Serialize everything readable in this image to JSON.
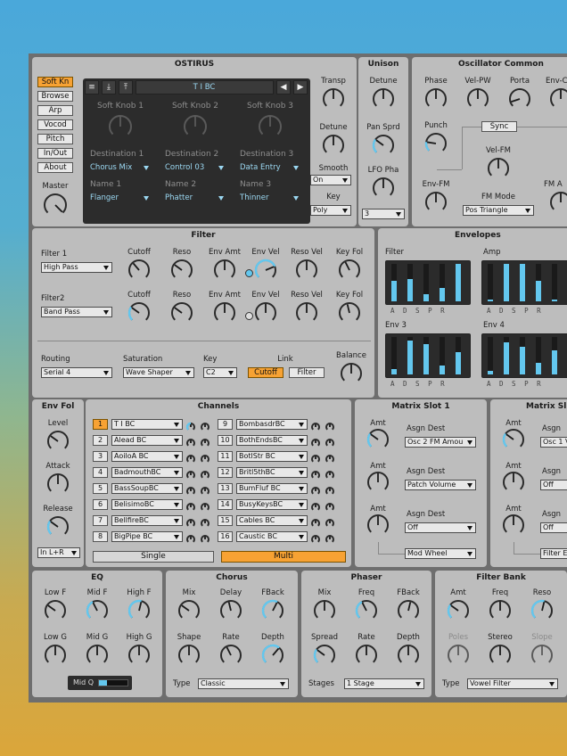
{
  "ostirus": {
    "title": "OSTIRUS",
    "side": [
      {
        "label": "Soft Kn",
        "on": true
      },
      {
        "label": "Browse",
        "on": false
      },
      {
        "label": "Arp",
        "on": false
      },
      {
        "label": "Vocod",
        "on": false
      },
      {
        "label": "Pitch",
        "on": false
      },
      {
        "label": "In/Out",
        "on": false
      },
      {
        "label": "About",
        "on": false
      }
    ],
    "master": "Master",
    "preset": "T I BC",
    "knobs": [
      "Soft Knob 1",
      "Soft Knob 2",
      "Soft Knob 3"
    ],
    "dest_labels": [
      "Destination 1",
      "Destination 2",
      "Destination 3"
    ],
    "dest_values": [
      "Chorus Mix",
      "Control 03",
      "Data Entry"
    ],
    "name_labels": [
      "Name 1",
      "Name 2",
      "Name 3"
    ],
    "name_values": [
      "Flanger",
      "Phatter",
      "Thinner"
    ],
    "transp": "Transp",
    "detune": "Detune",
    "smooth": "Smooth",
    "smooth_value": "On",
    "key": "Key",
    "key_value": "Poly"
  },
  "unison": {
    "title": "Unison",
    "detune": "Detune",
    "pan": "Pan Sprd",
    "lfo": "LFO Pha",
    "voices": "3"
  },
  "osc": {
    "title": "Oscillator Common",
    "phase": "Phase",
    "velpw": "Vel-PW",
    "porta": "Porta",
    "envc": "Env-C",
    "punch": "Punch",
    "sync": "Sync",
    "velfm": "Vel-FM",
    "envfm": "Env-FM",
    "fmmode": "FM Mode",
    "fmmode_value": "Pos Triangle",
    "fma": "FM A"
  },
  "filter": {
    "title": "Filter",
    "f1": "Filter 1",
    "f1_value": "High Pass",
    "f2": "Filter2",
    "f2_value": "Band Pass",
    "cols": [
      "Cutoff",
      "Reso",
      "Env Amt",
      "Env Vel",
      "Reso Vel",
      "Key Fol"
    ],
    "routing": "Routing",
    "routing_value": "Serial 4",
    "saturation": "Saturation",
    "saturation_value": "Wave Shaper",
    "key": "Key",
    "key_value": "C2",
    "link": "Link",
    "link_cutoff": "Cutoff",
    "link_filter": "Filter",
    "balance": "Balance"
  },
  "env": {
    "title": "Envelopes",
    "filter": "Filter",
    "amp": "Amp",
    "env3": "Env 3",
    "env4": "Env 4",
    "adsr": "A D S P R",
    "filter_levels": [
      0.55,
      0.6,
      0.2,
      0.35,
      1.0
    ],
    "amp_levels": [
      0.05,
      1.0,
      1.0,
      0.55,
      0.05
    ],
    "env3_levels": [
      0.15,
      0.9,
      0.8,
      0.25,
      0.6
    ],
    "env4_levels": [
      0.1,
      0.85,
      0.75,
      0.3,
      0.65
    ]
  },
  "envfol": {
    "title": "Env Fol",
    "level": "Level",
    "attack": "Attack",
    "release": "Release",
    "input": "In L+R"
  },
  "channels": {
    "title": "Channels",
    "left": [
      {
        "n": "1",
        "name": "T I BC",
        "on": true
      },
      {
        "n": "2",
        "name": "Alead BC",
        "on": false
      },
      {
        "n": "3",
        "name": "AoiloA BC",
        "on": false
      },
      {
        "n": "4",
        "name": "BadmouthBC",
        "on": false
      },
      {
        "n": "5",
        "name": "BassSoupBC",
        "on": false
      },
      {
        "n": "6",
        "name": "BelisimoBC",
        "on": false
      },
      {
        "n": "7",
        "name": "BellfireBC",
        "on": false
      },
      {
        "n": "8",
        "name": "BigPipe BC",
        "on": false
      }
    ],
    "right": [
      {
        "n": "9",
        "name": "BombasdrBC",
        "on": false
      },
      {
        "n": "10",
        "name": "BothEndsBC",
        "on": false
      },
      {
        "n": "11",
        "name": "BotlStr BC",
        "on": false
      },
      {
        "n": "12",
        "name": "Britl5thBC",
        "on": false
      },
      {
        "n": "13",
        "name": "BumFluf BC",
        "on": false
      },
      {
        "n": "14",
        "name": "BusyKeysBC",
        "on": false
      },
      {
        "n": "15",
        "name": "Cables BC",
        "on": false
      },
      {
        "n": "16",
        "name": "Caustic BC",
        "on": false
      }
    ],
    "single": "Single",
    "multi": "Multi"
  },
  "matrix1": {
    "title": "Matrix Slot 1",
    "amt": "Amt",
    "asgn": "Asgn Dest",
    "d1": "Osc 2 FM Amou",
    "d2": "Patch Volume",
    "d3": "Off",
    "source": "Mod Wheel"
  },
  "matrix2": {
    "title": "Matrix Sl",
    "amt": "Amt",
    "asgn": "Asgn",
    "d1": "Osc 1 V",
    "d2": "Off",
    "d3": "Off",
    "source": "Filter E"
  },
  "eq": {
    "title": "EQ",
    "row1": [
      "Low F",
      "Mid F",
      "High F"
    ],
    "row2": [
      "Low G",
      "Mid G",
      "High G"
    ],
    "midq": "Mid Q"
  },
  "chorus": {
    "title": "Chorus",
    "row1": [
      "Mix",
      "Delay",
      "FBack"
    ],
    "row2": [
      "Shape",
      "Rate",
      "Depth"
    ],
    "type": "Type",
    "type_value": "Classic"
  },
  "phaser": {
    "title": "Phaser",
    "row1": [
      "Mix",
      "Freq",
      "FBack"
    ],
    "row2": [
      "Spread",
      "Rate",
      "Depth"
    ],
    "stages": "Stages",
    "stages_value": "1 Stage"
  },
  "filterbank": {
    "title": "Filter Bank",
    "row1": [
      "Amt",
      "Freq",
      "Reso"
    ],
    "row2": [
      "Poles",
      "Stereo",
      "Slope"
    ],
    "type": "Type",
    "type_value": "Vowel Filter"
  }
}
